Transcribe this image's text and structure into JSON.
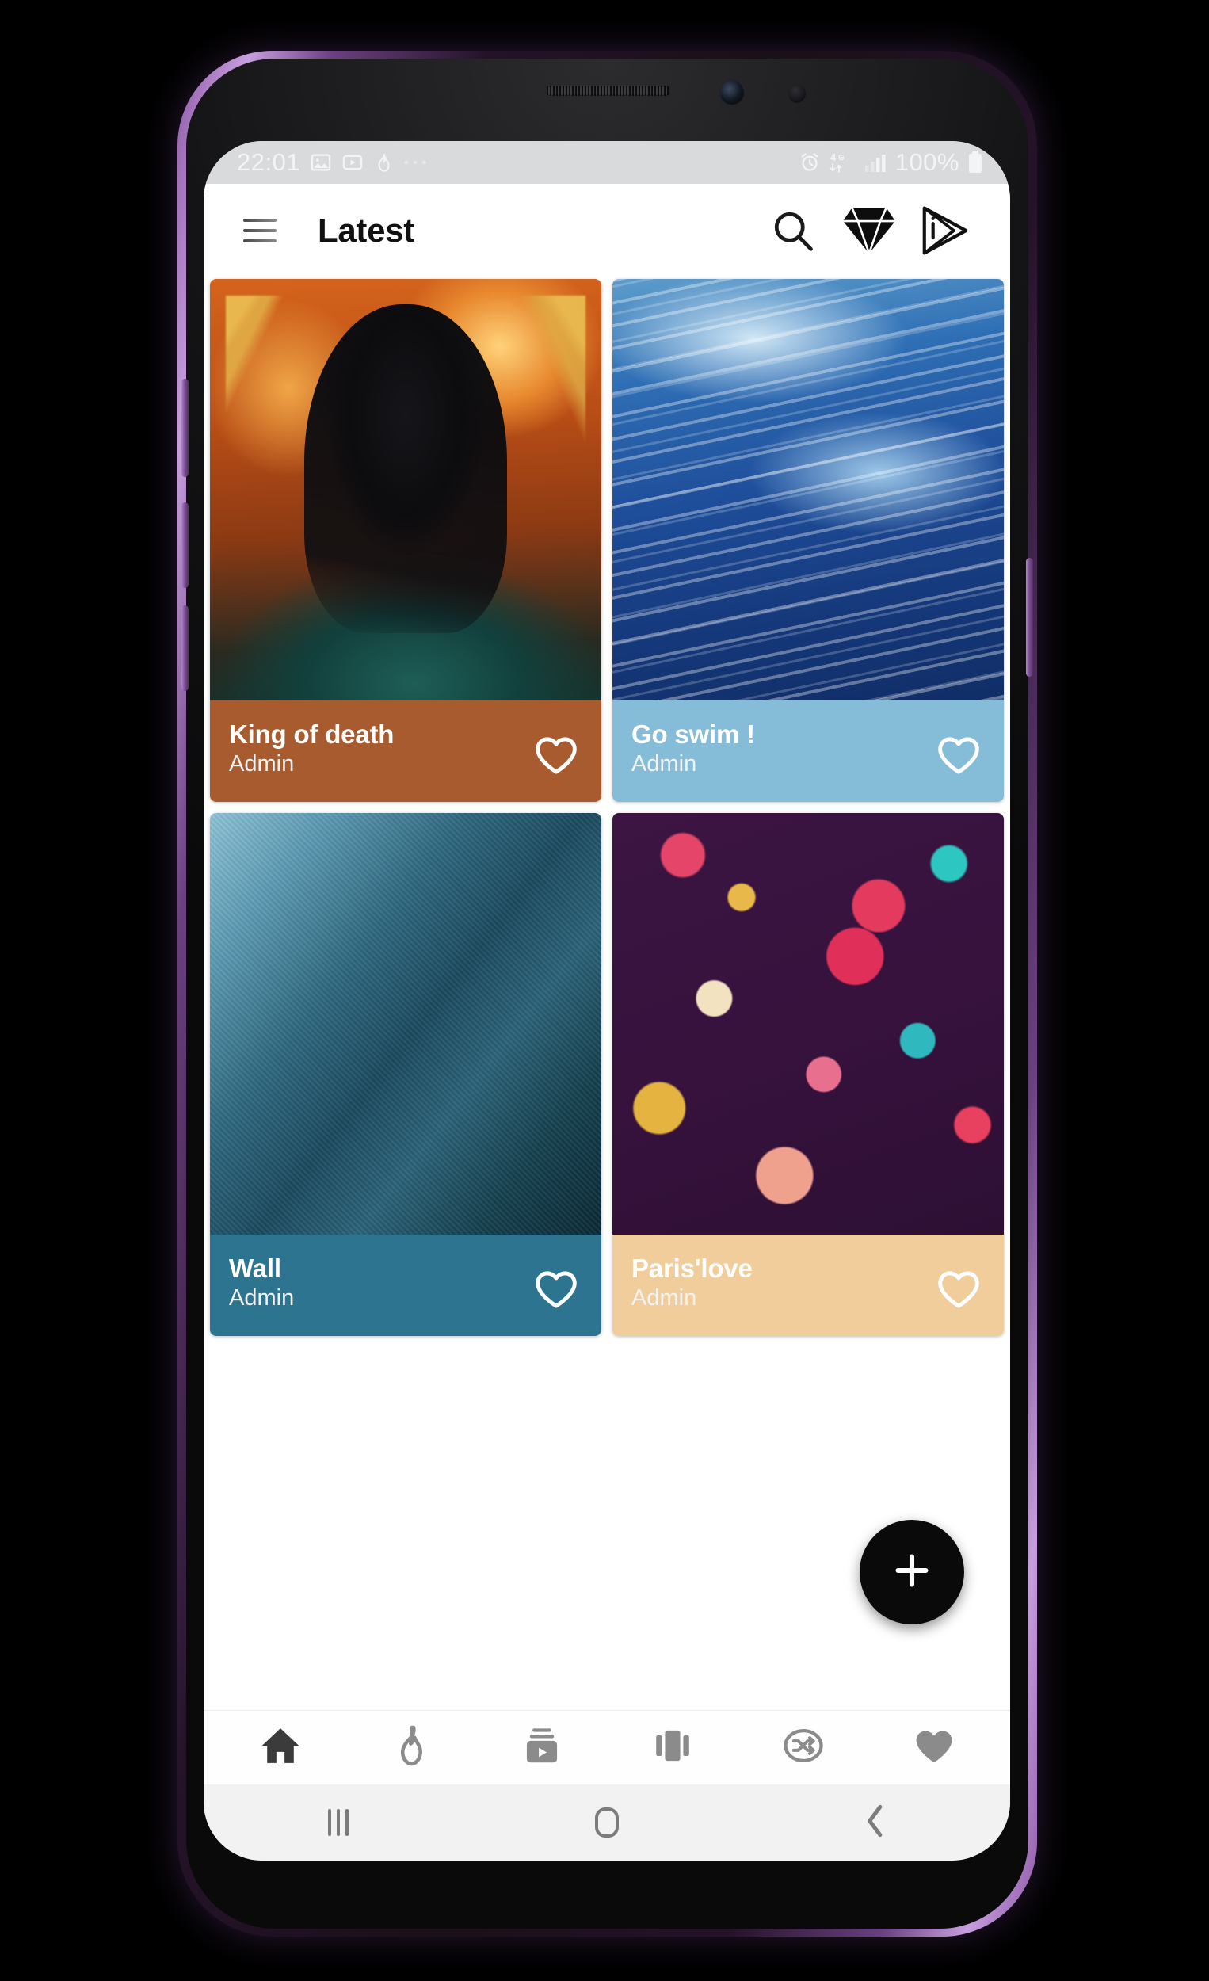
{
  "device": {
    "frame_color": "#8f5ba8",
    "body_color": "#121214"
  },
  "status_bar": {
    "time": "22:01",
    "left_icons": [
      "gallery-icon",
      "youtube-icon",
      "flame-icon",
      "more-dots-icon"
    ],
    "right_icons": [
      "alarm-icon",
      "network-4g-icon",
      "signal-bars-icon"
    ],
    "network_label": "4G",
    "battery_percent": "100%",
    "background": "#d9dadc"
  },
  "app_bar": {
    "menu_icon": "hamburger-menu-icon",
    "title": "Latest",
    "actions": [
      {
        "name": "search-icon",
        "label": "Search"
      },
      {
        "name": "diamond-icon",
        "label": "Premium"
      },
      {
        "name": "play-send-icon",
        "label": "Play Store"
      }
    ],
    "background": "#ffffff",
    "title_color": "#111111"
  },
  "grid": {
    "peek_cards": [
      {
        "name": "peek-card-left",
        "art": "art-peek-mauve",
        "color": "#9e7a86"
      },
      {
        "name": "peek-card-right",
        "art": "art-peek-rose",
        "color": "#d29a93"
      }
    ],
    "cards": [
      {
        "title": "King of death",
        "author": "Admin",
        "art": "art-reaper",
        "caption_bg": "#a85b2e",
        "fav_icon": "heart-outline-icon",
        "favorited": false
      },
      {
        "title": "Go swim !",
        "author": "Admin",
        "art": "art-ocean",
        "caption_bg": "#85bcd8",
        "fav_icon": "heart-outline-icon",
        "favorited": false
      },
      {
        "title": "Wall",
        "author": "Admin",
        "art": "art-wall",
        "caption_bg": "#2c7490",
        "fav_icon": "heart-outline-icon",
        "favorited": false
      },
      {
        "title": "Paris'love",
        "author": "Admin",
        "art": "art-paris",
        "caption_bg": "#f0cd9b",
        "fav_icon": "heart-outline-icon",
        "favorited": false
      }
    ]
  },
  "fab": {
    "icon": "plus-icon",
    "background": "#0a0a0a",
    "icon_color": "#ffffff"
  },
  "bottom_nav": {
    "items": [
      {
        "name": "nav-home",
        "icon": "home-icon",
        "active": true
      },
      {
        "name": "nav-trending",
        "icon": "flame-icon",
        "active": false
      },
      {
        "name": "nav-video",
        "icon": "video-icon",
        "active": false
      },
      {
        "name": "nav-carousel",
        "icon": "carousel-icon",
        "active": false
      },
      {
        "name": "nav-shuffle",
        "icon": "shuffle-icon",
        "active": false
      },
      {
        "name": "nav-favorites",
        "icon": "heart-filled-icon",
        "active": false
      }
    ],
    "active_color": "#3b3b3b",
    "inactive_color": "#8b8b8b",
    "background": "#fefefe"
  },
  "android_nav": {
    "items": [
      {
        "name": "android-recents-button",
        "icon": "recents-icon"
      },
      {
        "name": "android-home-button",
        "icon": "home-pill-icon"
      },
      {
        "name": "android-back-button",
        "icon": "back-chevron-icon"
      }
    ],
    "background": "#f2f2f2",
    "icon_color": "#7c7c7c"
  }
}
